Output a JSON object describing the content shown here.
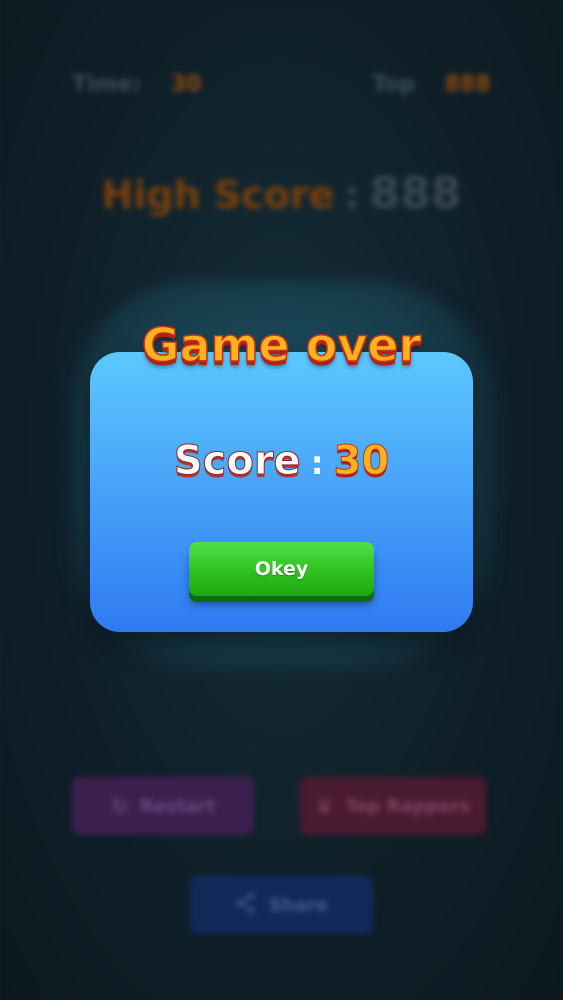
{
  "hud": {
    "time_label": "Time:",
    "time_value": "30",
    "top_label": "Top",
    "top_value": "888"
  },
  "high_score": {
    "label": "High Score",
    "separator": ":",
    "value": "888"
  },
  "buttons": {
    "restart_label": "Restart",
    "top_label": "Top Rappers",
    "share_label": "Share"
  },
  "dialog": {
    "title": "Game over",
    "score_label": "Score",
    "score_separator": ":",
    "score_value": "30",
    "okey_label": "Okey"
  },
  "colors": {
    "dialog_top": "#5cc8ff",
    "dialog_bottom": "#2f7af2",
    "title_fill": "#ffb21e",
    "title_outline": "#c0321b",
    "okey_button": "#2fc11f"
  },
  "icons": {
    "restart": "restart-icon",
    "top": "trophy-icon",
    "share": "share-icon"
  }
}
